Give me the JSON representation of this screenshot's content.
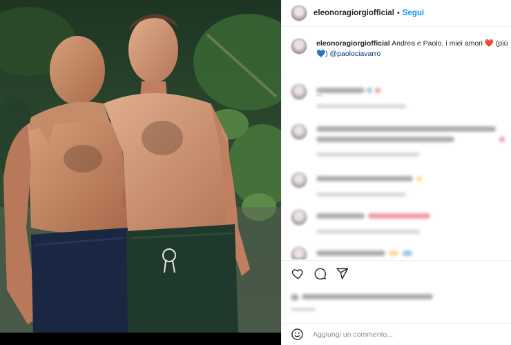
{
  "photo": {
    "description_icon": "photo-image"
  },
  "header": {
    "username": "eleonoragiorgiofficial",
    "separator": "•",
    "follow_label": "Segui"
  },
  "caption": {
    "username": "eleonoragiorgiofficial",
    "text": " Andrea e Paolo, i miei amori ",
    "heart": "❤️",
    "text_more": " (più",
    "line2_heart": "💙",
    "line2_text": ") ",
    "mention": "@paolociavarro"
  },
  "add_comment": {
    "placeholder": "Aggiungi un commento..."
  },
  "colors": {
    "follow_blue": "#0095f6",
    "text": "#262626",
    "secondary": "#8e8e8e"
  }
}
